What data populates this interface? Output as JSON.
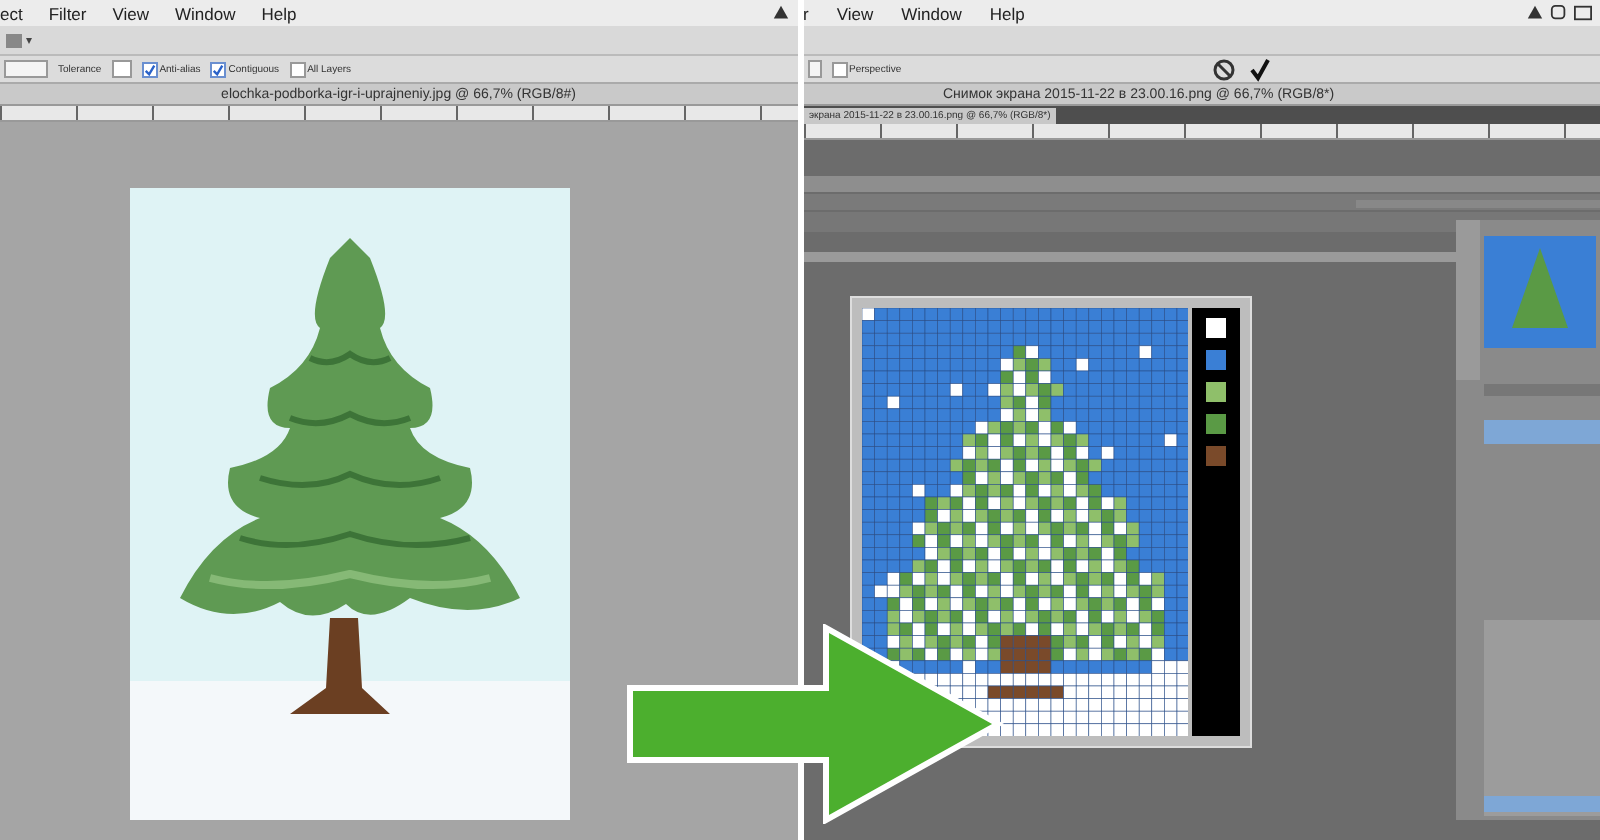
{
  "left_window": {
    "menu": [
      {
        "label": "ect"
      },
      {
        "label": "Filter"
      },
      {
        "label": "View"
      },
      {
        "label": "Window"
      },
      {
        "label": "Help"
      }
    ],
    "options": {
      "tolerance_label": "Tolerance",
      "checkboxes": [
        {
          "label": "Anti-alias",
          "checked": true
        },
        {
          "label": "Contiguous",
          "checked": true
        },
        {
          "label": "All Layers",
          "checked": false
        }
      ]
    },
    "document_title": "elochka-podborka-igr-i-uprajneniy.jpg @ 66,7% (RGB/8#)"
  },
  "right_window": {
    "menu": [
      {
        "label": "r"
      },
      {
        "label": "View"
      },
      {
        "label": "Window"
      },
      {
        "label": "Help"
      }
    ],
    "options": {
      "checkboxes": [
        {
          "label": "Perspective",
          "checked": false
        }
      ]
    },
    "document_title": "Снимок экрана 2015-11-22 в 23.00.16.png @ 66,7% (RGB/8*)",
    "tab_title": "экрана 2015-11-22 в 23.00.16.png @ 66,7% (RGB/8*)",
    "palette": [
      {
        "color": "#ffffff"
      },
      {
        "color": "#3a7fd5"
      },
      {
        "color": "#8fbf6a"
      },
      {
        "color": "#5a9a45"
      },
      {
        "color": "#7a4a2a"
      }
    ]
  }
}
